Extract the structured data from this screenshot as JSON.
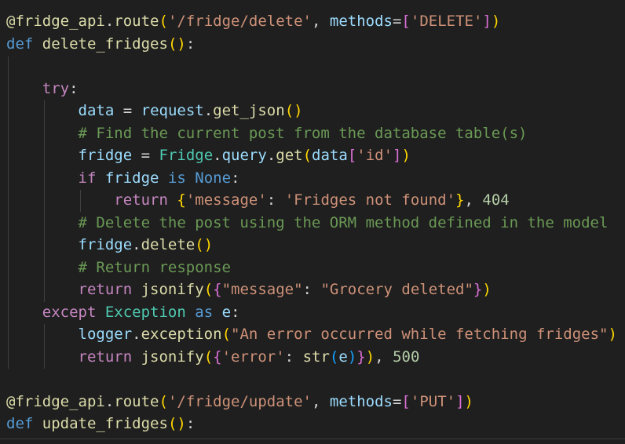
{
  "code": {
    "language": "python",
    "lines": [
      "@fridge_api.route('/fridge/delete', methods=['DELETE'])",
      "def delete_fridges():",
      "",
      "    try:",
      "        data = request.get_json()",
      "        # Find the current post from the database table(s)",
      "        fridge = Fridge.query.get(data['id'])",
      "        if fridge is None:",
      "            return {'message': 'Fridges not found'}, 404",
      "        # Delete the post using the ORM method defined in the model",
      "        fridge.delete()",
      "        # Return response",
      "        return jsonify({\"message\": \"Grocery deleted\"})",
      "    except Exception as e:",
      "        logger.exception(\"An error occurred while fetching fridges\")",
      "        return jsonify({'error': str(e)}), 500",
      "",
      "@fridge_api.route('/fridge/update', methods=['PUT'])",
      "def update_fridges():"
    ]
  },
  "theme": {
    "background": "#1f1f1f",
    "keyword": "#569cd6",
    "control": "#c586c0",
    "function": "#dcdcaa",
    "variable": "#9cdcfe",
    "string": "#ce9178",
    "comment": "#6a9955",
    "class": "#4ec9b0",
    "number": "#b5cea8"
  }
}
